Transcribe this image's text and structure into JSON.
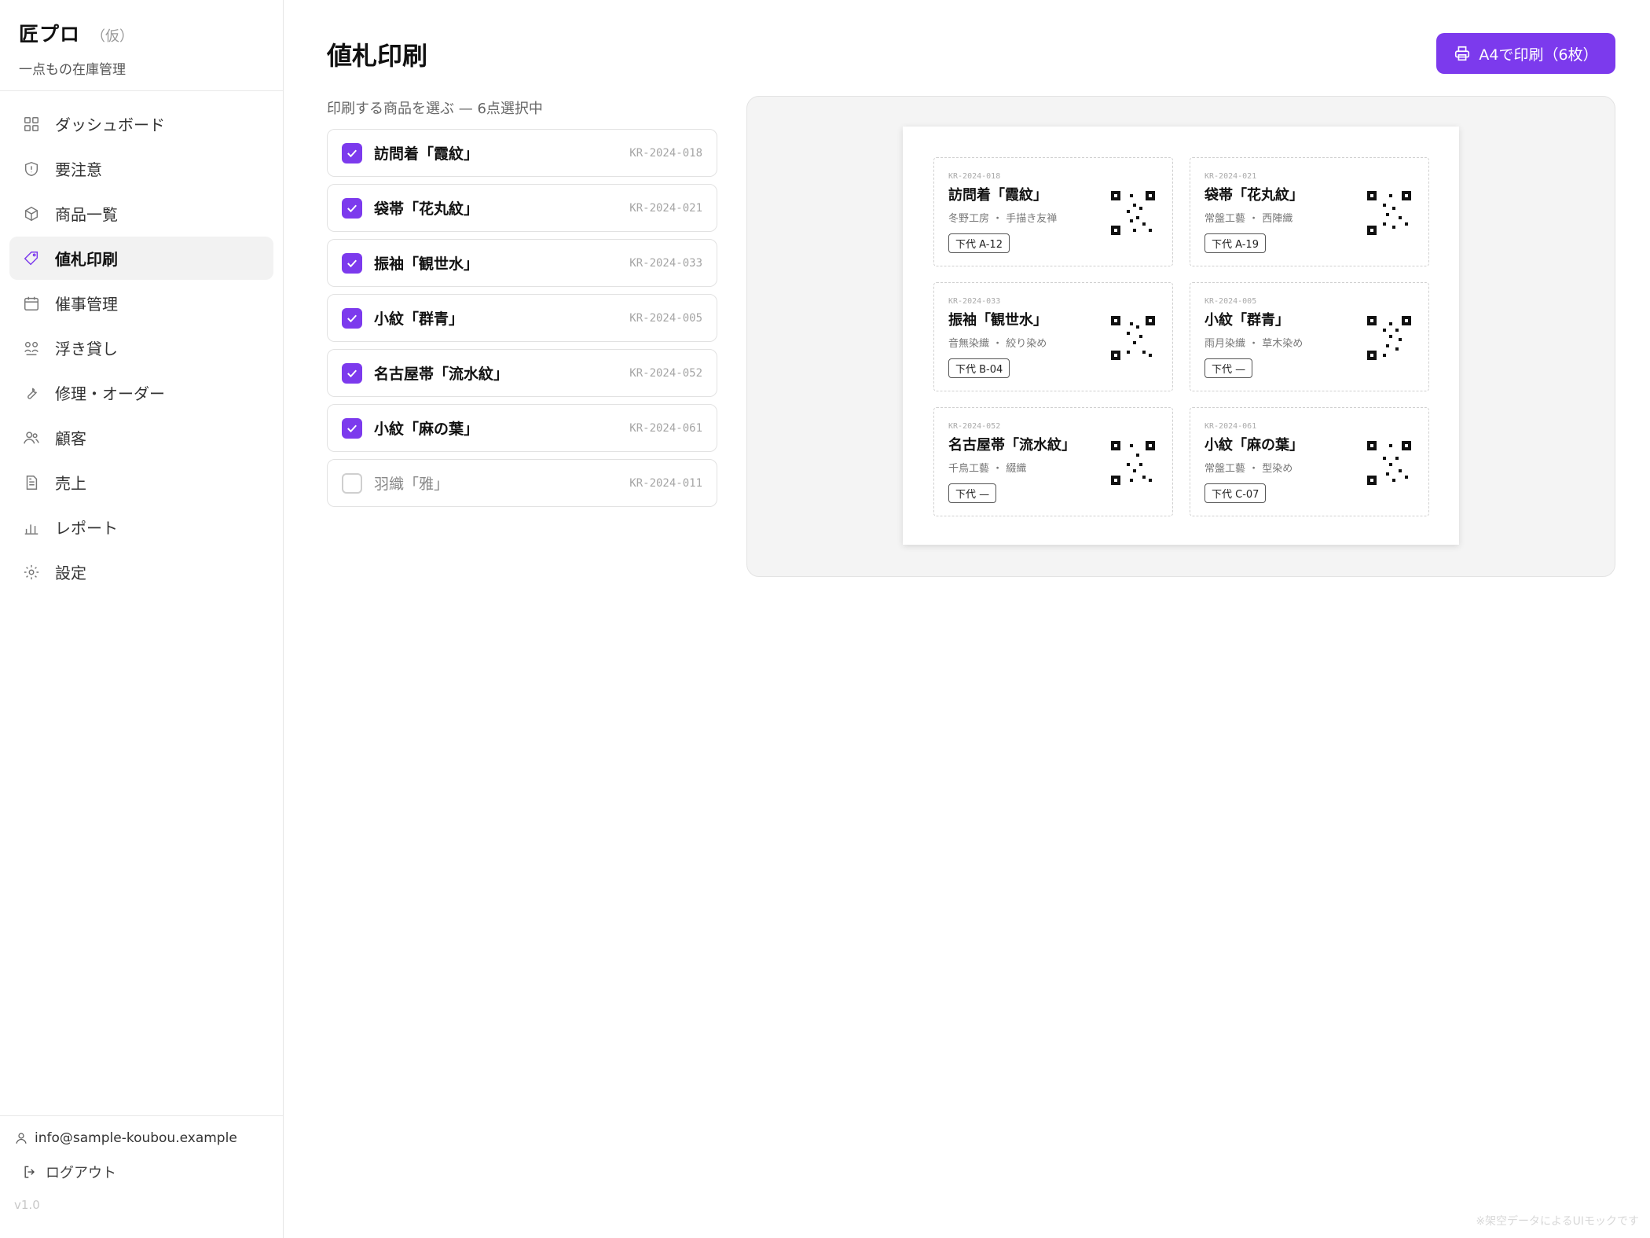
{
  "app": {
    "title": "匠プロ",
    "tag": "（仮）",
    "subtitle": "一点もの在庫管理"
  },
  "nav": [
    {
      "label": "ダッシュボード",
      "icon": "grid-icon",
      "active": false
    },
    {
      "label": "要注意",
      "icon": "shield-icon",
      "active": false
    },
    {
      "label": "商品一覧",
      "icon": "box-icon",
      "active": false
    },
    {
      "label": "値札印刷",
      "icon": "tag-icon",
      "active": true
    },
    {
      "label": "催事管理",
      "icon": "calendar-icon",
      "active": false
    },
    {
      "label": "浮き貸し",
      "icon": "share-icon",
      "active": false
    },
    {
      "label": "修理・オーダー",
      "icon": "wrench-icon",
      "active": false
    },
    {
      "label": "顧客",
      "icon": "users-icon",
      "active": false
    },
    {
      "label": "売上",
      "icon": "document-icon",
      "active": false
    },
    {
      "label": "レポート",
      "icon": "bar-chart-icon",
      "active": false
    },
    {
      "label": "設定",
      "icon": "gear-icon",
      "active": false
    }
  ],
  "footer": {
    "email": "info@sample-koubou.example",
    "logout": "ログアウト",
    "version": "v1.0"
  },
  "page": {
    "title": "値札印刷",
    "print_button": "A4で印刷（6枚）",
    "select_label": "印刷する商品を選ぶ — 6点選択中"
  },
  "items": [
    {
      "name": "訪問着「霞紋」",
      "code": "KR-2024-018",
      "checked": true
    },
    {
      "name": "袋帯「花丸紋」",
      "code": "KR-2024-021",
      "checked": true
    },
    {
      "name": "振袖「観世水」",
      "code": "KR-2024-033",
      "checked": true
    },
    {
      "name": "小紋「群青」",
      "code": "KR-2024-005",
      "checked": true
    },
    {
      "name": "名古屋帯「流水紋」",
      "code": "KR-2024-052",
      "checked": true
    },
    {
      "name": "小紋「麻の葉」",
      "code": "KR-2024-061",
      "checked": true
    },
    {
      "name": "羽織「雅」",
      "code": "KR-2024-011",
      "checked": false
    }
  ],
  "tags": [
    {
      "code": "KR-2024-018",
      "name": "訪問着「霞紋」",
      "maker": "冬野工房 ・ 手描き友禅",
      "price": "下代 A-12"
    },
    {
      "code": "KR-2024-021",
      "name": "袋帯「花丸紋」",
      "maker": "常盤工藝 ・ 西陣織",
      "price": "下代 A-19"
    },
    {
      "code": "KR-2024-033",
      "name": "振袖「観世水」",
      "maker": "音無染織 ・ 絞り染め",
      "price": "下代 B-04"
    },
    {
      "code": "KR-2024-005",
      "name": "小紋「群青」",
      "maker": "雨月染織 ・ 草木染め",
      "price": "下代 —"
    },
    {
      "code": "KR-2024-052",
      "name": "名古屋帯「流水紋」",
      "maker": "千鳥工藝 ・ 綴織",
      "price": "下代 —"
    },
    {
      "code": "KR-2024-061",
      "name": "小紋「麻の葉」",
      "maker": "常盤工藝 ・ 型染め",
      "price": "下代 C-07"
    }
  ],
  "footnote": "※架空データによるUIモックです",
  "colors": {
    "accent": "#7c3aed"
  }
}
